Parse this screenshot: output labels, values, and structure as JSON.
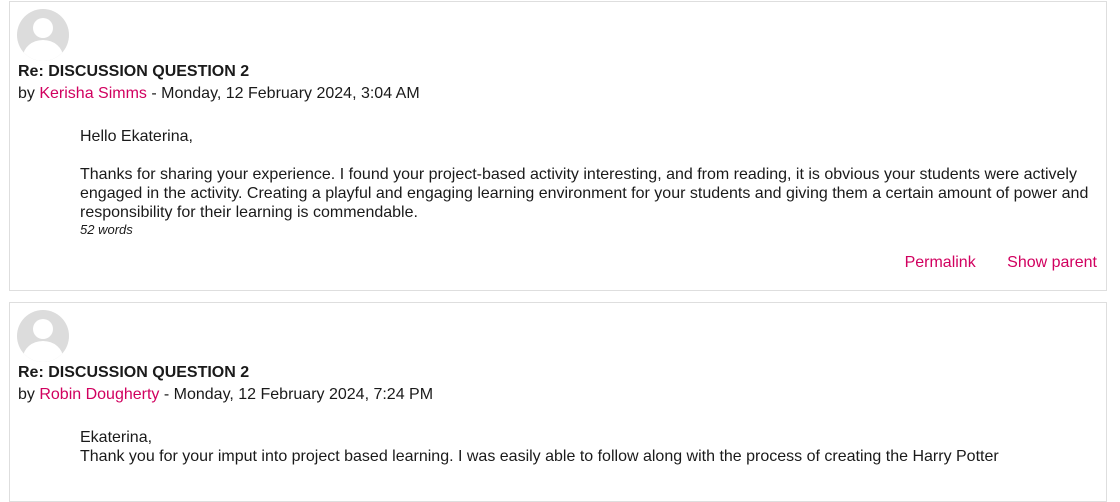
{
  "posts": [
    {
      "subject": "Re: DISCUSSION QUESTION 2",
      "by_prefix": "by",
      "author": "Kerisha Simms",
      "date": " - Monday, 12 February 2024, 3:04 AM",
      "greeting": "Hello Ekaterina,",
      "body": "Thanks for sharing your experience. I found your project-based activity interesting, and from reading, it is obvious your students were actively engaged in the activity. Creating a playful and engaging learning environment for your students and giving them a certain amount of power and responsibility for their learning is commendable.",
      "word_count": "52 words",
      "actions": {
        "permalink": "Permalink",
        "show_parent": "Show parent"
      }
    },
    {
      "subject": "Re: DISCUSSION QUESTION 2",
      "by_prefix": "by",
      "author": "Robin Dougherty",
      "date": " - Monday, 12 February 2024, 7:24 PM",
      "greeting": "Ekaterina,",
      "body": "Thank you for your imput into project based learning. I was easily able to follow along with the process of creating the Harry Potter"
    }
  ],
  "colors": {
    "link": "#d1005f",
    "border": "#dedede",
    "avatar": "#dcdcdc"
  },
  "icons": {
    "avatar": "default-user-avatar-icon"
  }
}
